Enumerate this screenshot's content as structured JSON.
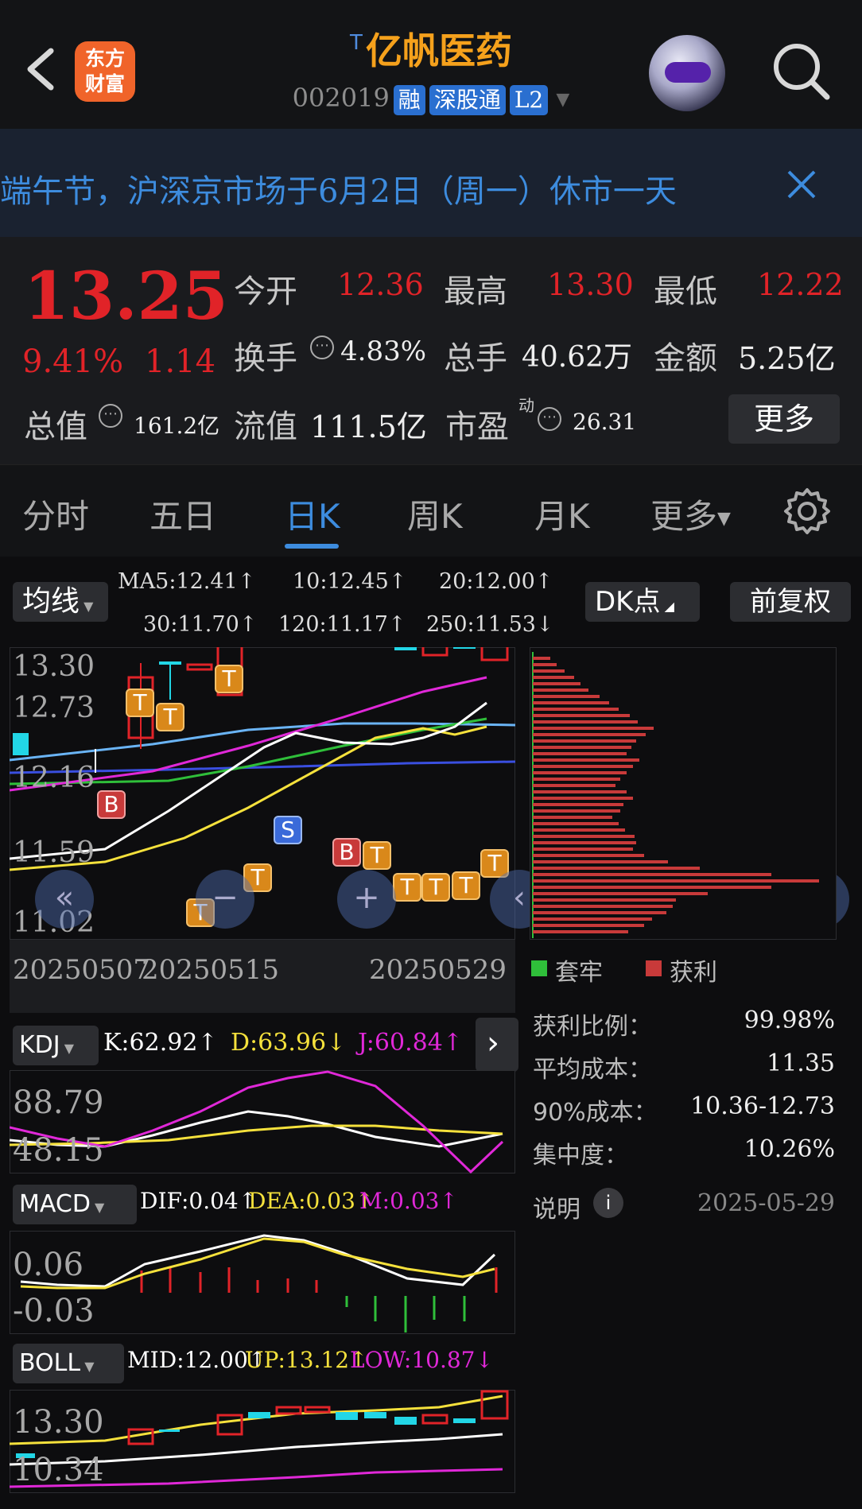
{
  "header": {
    "logo_line1": "东方",
    "logo_line2": "财富",
    "title_mark": "T",
    "title": "亿帆医药",
    "code": "002019",
    "tags": [
      "融",
      "深股通",
      "L2"
    ]
  },
  "notice": {
    "text": "端午节，沪深京市场于6月2日（周一）休市一天"
  },
  "quote": {
    "price": "13.25",
    "change_pct": "9.41%",
    "change": "1.14",
    "open_label": "今开",
    "open": "12.36",
    "high_label": "最高",
    "high": "13.30",
    "low_label": "最低",
    "low": "12.22",
    "turnover_label": "换手",
    "turnover": "4.83%",
    "volume_label": "总手",
    "volume": "40.62万",
    "amount_label": "金额",
    "amount": "5.25亿",
    "mktcap_label": "总值",
    "mktcap": "161.2亿",
    "float_label": "流值",
    "float": "111.5亿",
    "pe_label": "市盈",
    "pe_sup": "动",
    "pe": "26.31",
    "more": "更多"
  },
  "tabs": [
    "分时",
    "五日",
    "日K",
    "周K",
    "月K",
    "更多"
  ],
  "chart": {
    "ma_selector": "均线",
    "ma": [
      {
        "text": "MA5:12.41↑",
        "color": "#ffffff"
      },
      {
        "text": "10:12.45↑",
        "color": "#f5e13c"
      },
      {
        "text": "20:12.00↑",
        "color": "#e028d8"
      },
      {
        "text": "30:11.70↑",
        "color": "#2fbf3a"
      },
      {
        "text": "120:11.17↑",
        "color": "#3a4fe0"
      },
      {
        "text": "250:11.53↓",
        "color": "#6ab4f5"
      }
    ],
    "dk_button": "DK点",
    "adjust_button": "前复权",
    "price_axis": [
      "13.30",
      "12.73",
      "12.16",
      "11.59",
      "11.02"
    ],
    "date_axis": [
      "20250507",
      "20250515",
      "20250529"
    ],
    "markers": [
      "B",
      "T",
      "T",
      "T",
      "S",
      "B",
      "T",
      "T",
      "T",
      "T",
      "T",
      "T",
      "T"
    ],
    "legend_trapped": "套牢",
    "legend_profit": "获利",
    "chips": [
      {
        "label": "获利比例：",
        "value": "99.98%"
      },
      {
        "label": "平均成本：",
        "value": "11.35"
      },
      {
        "label": "90%成本：",
        "value": "10.36-12.73"
      },
      {
        "label": "集中度：",
        "value": "10.26%"
      }
    ],
    "explain_label": "说明",
    "chip_date": "2025-05-29"
  },
  "indicators": {
    "kdj": {
      "name": "KDJ",
      "k": "K:62.92↑",
      "d": "D:63.96↓",
      "j": "J:60.84↑",
      "axis": [
        "88.79",
        "48.15"
      ]
    },
    "macd": {
      "name": "MACD",
      "dif": "DIF:0.04↑",
      "dea": "DEA:0.03↑",
      "m": "M:0.03↑",
      "axis": [
        "0.06",
        "-0.03"
      ]
    },
    "boll": {
      "name": "BOLL",
      "mid": "MID:12.00↑",
      "up": "UP:13.12↑",
      "low": "LOW:10.87↓",
      "axis": [
        "13.30",
        "10.34"
      ]
    }
  },
  "colors": {
    "up": "#e12328",
    "down": "#22d6e6",
    "accent": "#3d8cde",
    "title": "#f5a11c"
  }
}
